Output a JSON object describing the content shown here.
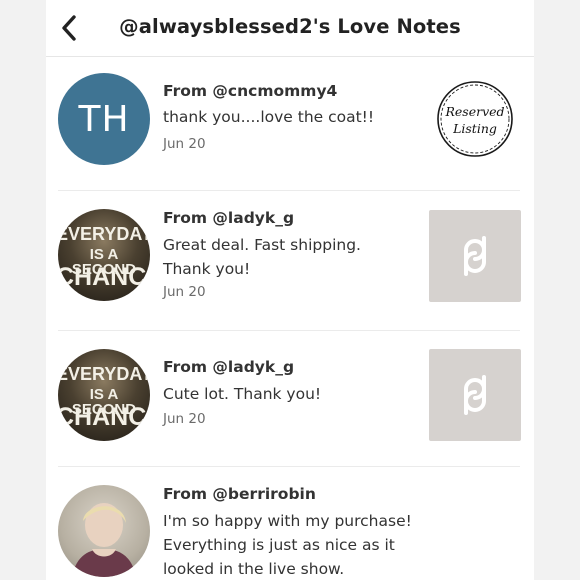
{
  "header": {
    "title": "@alwaysblessed2's Love Notes"
  },
  "notes": [
    {
      "from": "From @cncmommy4",
      "avatar_initials": "TH",
      "message": "thank you....love the coat!!",
      "date": "Jun 20",
      "thumbnail_text": [
        "Reserved",
        "Listing"
      ]
    },
    {
      "from": "From @ladyk_g",
      "avatar_text": [
        "EVERYDAY",
        "IS A SECOND",
        "CHANCE"
      ],
      "message": "Great deal. Fast shipping. Thank you!",
      "date": "Jun 20",
      "thumbnail_icon": "poshmark-logo-icon"
    },
    {
      "from": "From @ladyk_g",
      "avatar_text": [
        "EVERYDAY",
        "IS A SECOND",
        "CHANCE"
      ],
      "message": "Cute lot. Thank you!",
      "date": "Jun 20",
      "thumbnail_icon": "poshmark-logo-icon"
    },
    {
      "from": "From @berrirobin",
      "avatar_icon": "user-photo",
      "message": "I'm so happy with my purchase! Everything is just as nice as it looked in the live show."
    }
  ],
  "colors": {
    "avatar_th": "#3f7493",
    "placeholder": "#d6d2cf"
  }
}
